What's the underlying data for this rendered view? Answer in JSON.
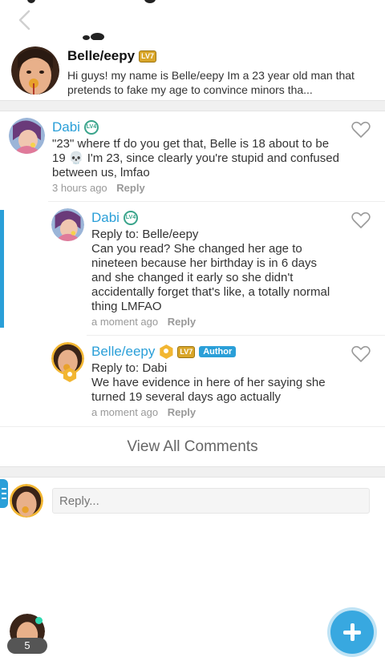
{
  "post": {
    "author": "Belle/eepy",
    "level": "LV7",
    "text": "Hi guys! my name is Belle/eepy Im a 23 year old man that pretends to fake my age to convince minors tha..."
  },
  "comments": [
    {
      "author": "Dabi",
      "level": "LV4",
      "text": "\"23\" where tf do you get that, Belle is 18 about to be 19 💀 I'm 23, since clearly you're stupid and confused between us, lmfao",
      "time": "3 hours ago",
      "reply_label": "Reply"
    },
    {
      "author": "Dabi",
      "level": "LV4",
      "reply_to": "Reply to: Belle/eepy",
      "text": "Can you read? She changed her age to nineteen because her birthday is in 6 days and she changed it early so she didn't accidentally forget that's like, a totally normal thing LMFAO",
      "time": "a moment ago",
      "reply_label": "Reply"
    },
    {
      "author": "Belle/eepy",
      "level": "LV7",
      "tag": "Author",
      "reply_to": "Reply to: Dabi",
      "text": "We have evidence in here of her saying she turned 19 several days ago actually",
      "time": "a moment ago",
      "reply_label": "Reply"
    }
  ],
  "view_all_label": "View All Comments",
  "reply_input": {
    "placeholder": "Reply..."
  },
  "notifications": {
    "count": "5"
  },
  "colors": {
    "accent": "#2a9fd8",
    "fab": "#38a8e0",
    "online": "#2fd9b0"
  },
  "icons": [
    "chevron-left-icon",
    "heart-outline-icon",
    "plus-icon",
    "menu-icon"
  ]
}
